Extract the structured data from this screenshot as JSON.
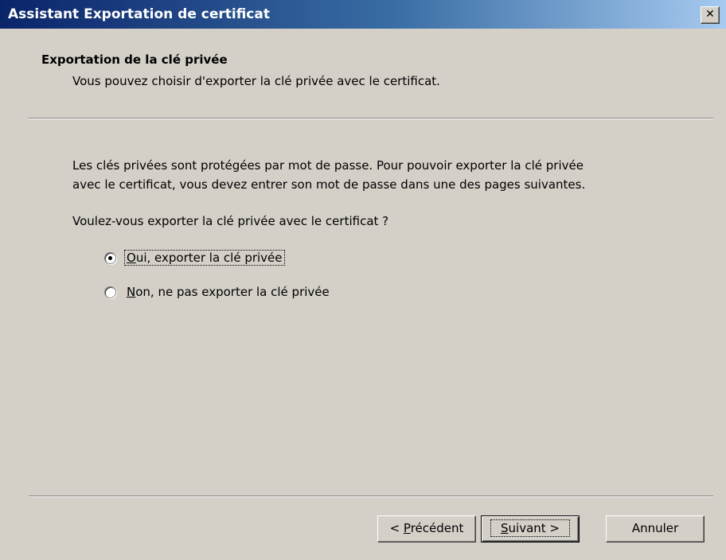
{
  "window": {
    "title": "Assistant Exportation de certificat",
    "close_symbol": "✕"
  },
  "header": {
    "title": "Exportation de la clé privée",
    "subtitle": "Vous pouvez choisir d'exporter la clé privée avec le certificat."
  },
  "content": {
    "description_line1": "Les clés privées sont protégées par mot de passe. Pour pouvoir exporter la clé privée",
    "description_line2": "avec le certificat, vous devez entrer son mot de passe dans une des pages suivantes.",
    "question": "Voulez-vous exporter la clé privée avec le certificat ?",
    "options": [
      {
        "mnemonic": "O",
        "rest": "ui, exporter la clé privée",
        "selected": true
      },
      {
        "mnemonic": "N",
        "rest": "on, ne pas exporter la clé privée",
        "selected": false
      }
    ]
  },
  "buttons": {
    "prev_prefix": "< ",
    "prev_mnemonic": "P",
    "prev_rest": "récédent",
    "next_mnemonic": "S",
    "next_rest": "uivant >",
    "cancel": "Annuler"
  }
}
